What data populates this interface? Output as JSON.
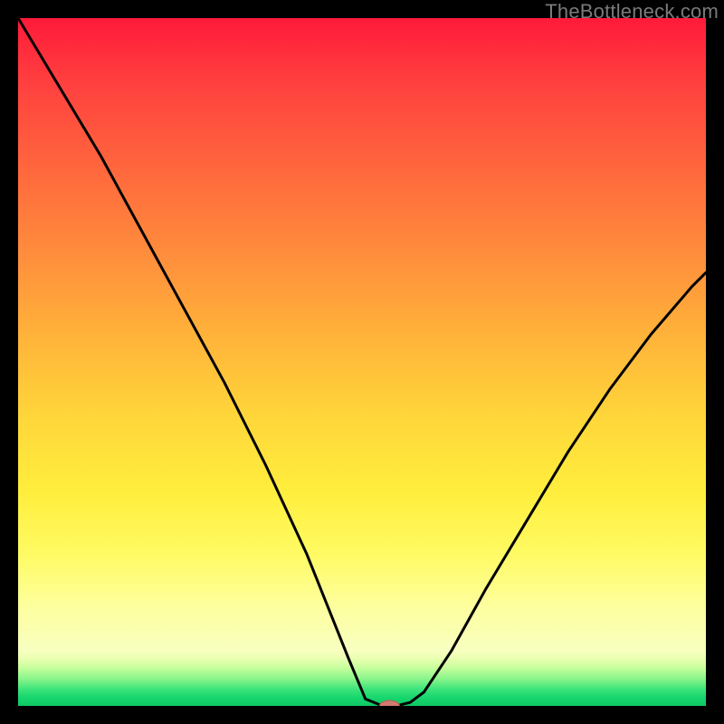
{
  "watermark": "TheBottleneck.com",
  "chart_data": {
    "type": "line",
    "title": "",
    "xlabel": "",
    "ylabel": "",
    "xlim": [
      0,
      100
    ],
    "ylim": [
      0,
      100
    ],
    "x": [
      0,
      6,
      12,
      18,
      24,
      30,
      36,
      42,
      48,
      50.5,
      53,
      55,
      57,
      59,
      63,
      68,
      74,
      80,
      86,
      92,
      98,
      100
    ],
    "y": [
      100,
      90,
      80,
      69,
      58,
      47,
      35,
      22,
      7,
      1,
      0,
      0,
      0.5,
      2,
      8,
      17,
      27,
      37,
      46,
      54,
      61,
      63
    ],
    "marker": {
      "x": 54,
      "y": 0
    },
    "background_gradient": {
      "top": "#ff1a3a",
      "mid": "#ffee3d",
      "bottom": "#0fc964"
    }
  }
}
